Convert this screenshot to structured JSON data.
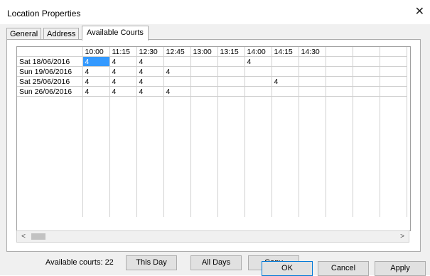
{
  "window": {
    "title": "Location Properties",
    "close_glyph": "✕"
  },
  "tabs": [
    {
      "label": "General",
      "active": false
    },
    {
      "label": "Address",
      "active": false
    },
    {
      "label": "Available Courts",
      "active": true
    }
  ],
  "grid": {
    "columns": [
      "10:00",
      "11:15",
      "12:30",
      "12:45",
      "13:00",
      "13:15",
      "14:00",
      "14:15",
      "14:30",
      "",
      "",
      ""
    ],
    "rows": [
      {
        "date": "Sat 18/06/2016",
        "cells": [
          "4",
          "4",
          "4",
          "",
          "",
          "",
          "4",
          "",
          "",
          "",
          "",
          ""
        ]
      },
      {
        "date": "Sun 19/06/2016",
        "cells": [
          "4",
          "4",
          "4",
          "4",
          "",
          "",
          "",
          "",
          "",
          "",
          "",
          ""
        ]
      },
      {
        "date": "Sat 25/06/2016",
        "cells": [
          "4",
          "4",
          "4",
          "",
          "",
          "",
          "",
          "4",
          "",
          "",
          "",
          ""
        ]
      },
      {
        "date": "Sun 26/06/2016",
        "cells": [
          "4",
          "4",
          "4",
          "4",
          "",
          "",
          "",
          "",
          "",
          "",
          "",
          ""
        ]
      }
    ],
    "selected_cell": {
      "row": 0,
      "col": 0
    }
  },
  "scrollbar": {
    "left_glyph": "<",
    "right_glyph": ">"
  },
  "footer": {
    "available_courts": "Available courts: 22",
    "this_day_label": "This Day",
    "all_days_label": "All Days",
    "copy_label": "Copy"
  },
  "dialog_buttons": {
    "ok_label": "OK",
    "cancel_label": "Cancel",
    "apply_label": "Apply"
  },
  "colors": {
    "selection": "#3399ff",
    "dialog_bg": "#f0f0f0",
    "default_button_border": "#0078d7"
  }
}
